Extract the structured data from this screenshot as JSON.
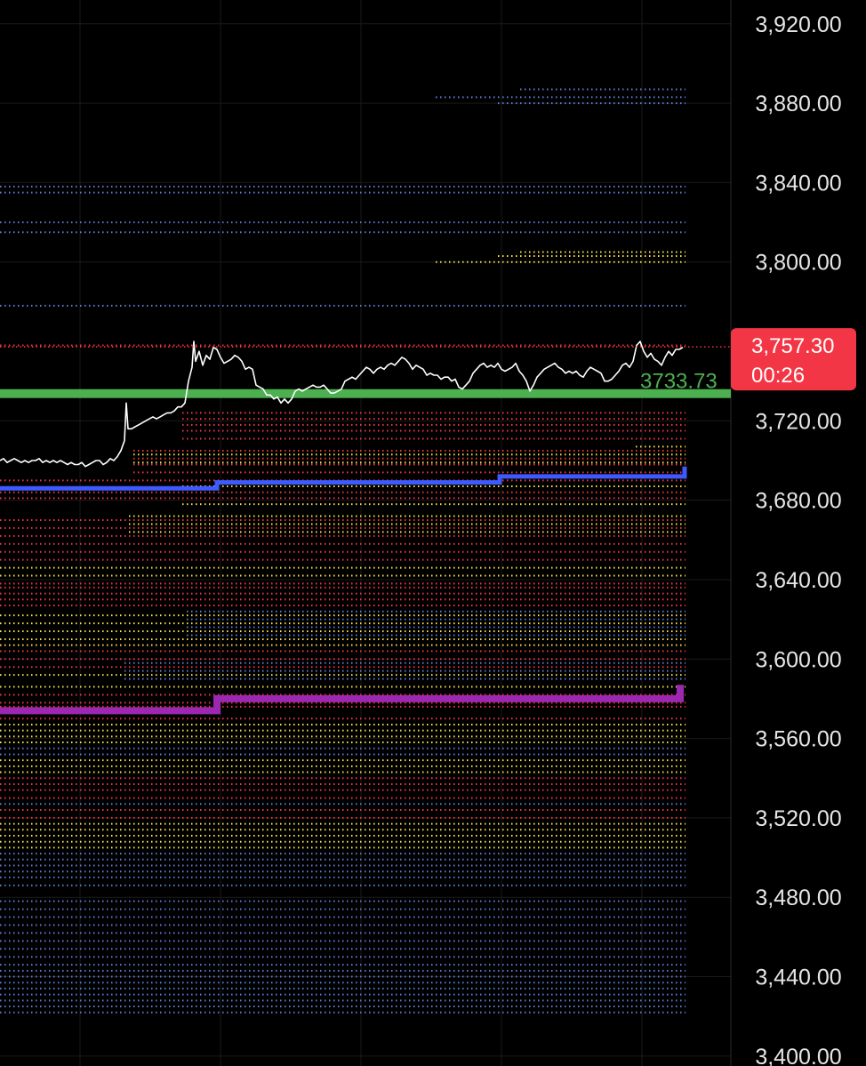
{
  "chart_data": {
    "type": "line",
    "instrument_price_axis": {
      "ylim": [
        3395,
        3932
      ],
      "tick_labels": [
        "3,920.00",
        "3,880.00",
        "3,840.00",
        "3,800.00",
        "3,720.00",
        "3,680.00",
        "3,640.00",
        "3,600.00",
        "3,560.00",
        "3,520.00",
        "3,480.00",
        "3,440.00",
        "3,400.00"
      ],
      "tick_values": [
        3920,
        3880,
        3840,
        3800,
        3720,
        3680,
        3640,
        3600,
        3560,
        3520,
        3480,
        3440,
        3400
      ]
    },
    "grid": true,
    "last_price": {
      "value": 3757.3,
      "label": "3,757.30",
      "countdown": "00:26",
      "color": "#f23645"
    },
    "marker_line": {
      "value": 3733.73,
      "label": "3733.73",
      "color": "#4caf50"
    },
    "price_series": {
      "color": "#ffffff",
      "points": [
        [
          0,
          3700
        ],
        [
          4,
          3701
        ],
        [
          8,
          3699
        ],
        [
          12,
          3700
        ],
        [
          16,
          3701
        ],
        [
          20,
          3700
        ],
        [
          24,
          3699
        ],
        [
          28,
          3700
        ],
        [
          32,
          3699
        ],
        [
          36,
          3700
        ],
        [
          40,
          3700
        ],
        [
          44,
          3701
        ],
        [
          48,
          3699
        ],
        [
          52,
          3700
        ],
        [
          56,
          3699
        ],
        [
          60,
          3700
        ],
        [
          64,
          3699
        ],
        [
          68,
          3700
        ],
        [
          72,
          3699
        ],
        [
          76,
          3698
        ],
        [
          80,
          3699
        ],
        [
          84,
          3698
        ],
        [
          88,
          3698
        ],
        [
          92,
          3699
        ],
        [
          96,
          3697
        ],
        [
          100,
          3698
        ],
        [
          104,
          3699
        ],
        [
          108,
          3700
        ],
        [
          112,
          3700
        ],
        [
          116,
          3698
        ],
        [
          120,
          3699
        ],
        [
          124,
          3701
        ],
        [
          128,
          3700
        ],
        [
          132,
          3702
        ],
        [
          136,
          3705
        ],
        [
          140,
          3710
        ],
        [
          142,
          3729
        ],
        [
          144,
          3716
        ],
        [
          148,
          3716
        ],
        [
          152,
          3717
        ],
        [
          156,
          3718
        ],
        [
          160,
          3719
        ],
        [
          164,
          3720
        ],
        [
          168,
          3721
        ],
        [
          172,
          3722
        ],
        [
          176,
          3721
        ],
        [
          180,
          3722
        ],
        [
          184,
          3723
        ],
        [
          188,
          3724
        ],
        [
          192,
          3724
        ],
        [
          196,
          3725
        ],
        [
          200,
          3727
        ],
        [
          204,
          3727
        ],
        [
          208,
          3729
        ],
        [
          212,
          3740
        ],
        [
          216,
          3747
        ],
        [
          218,
          3760
        ],
        [
          220,
          3750
        ],
        [
          224,
          3755
        ],
        [
          228,
          3748
        ],
        [
          232,
          3753
        ],
        [
          236,
          3751
        ],
        [
          240,
          3757
        ],
        [
          244,
          3756
        ],
        [
          248,
          3752
        ],
        [
          252,
          3749
        ],
        [
          256,
          3750
        ],
        [
          260,
          3751
        ],
        [
          264,
          3753
        ],
        [
          268,
          3752
        ],
        [
          272,
          3750
        ],
        [
          276,
          3746
        ],
        [
          280,
          3747
        ],
        [
          284,
          3746
        ],
        [
          288,
          3738
        ],
        [
          292,
          3737
        ],
        [
          296,
          3736
        ],
        [
          300,
          3733
        ],
        [
          304,
          3733
        ],
        [
          308,
          3731
        ],
        [
          312,
          3732
        ],
        [
          316,
          3729
        ],
        [
          320,
          3731
        ],
        [
          324,
          3729
        ],
        [
          328,
          3731
        ],
        [
          332,
          3735
        ],
        [
          336,
          3736
        ],
        [
          340,
          3735
        ],
        [
          344,
          3736
        ],
        [
          348,
          3737
        ],
        [
          352,
          3738
        ],
        [
          356,
          3737
        ],
        [
          360,
          3737
        ],
        [
          364,
          3738
        ],
        [
          368,
          3736
        ],
        [
          372,
          3734
        ],
        [
          376,
          3734
        ],
        [
          380,
          3735
        ],
        [
          384,
          3736
        ],
        [
          388,
          3740
        ],
        [
          392,
          3741
        ],
        [
          396,
          3742
        ],
        [
          400,
          3741
        ],
        [
          404,
          3743
        ],
        [
          408,
          3745
        ],
        [
          412,
          3747
        ],
        [
          416,
          3746
        ],
        [
          420,
          3744
        ],
        [
          424,
          3746
        ],
        [
          428,
          3747
        ],
        [
          432,
          3746
        ],
        [
          436,
          3748
        ],
        [
          440,
          3749
        ],
        [
          444,
          3748
        ],
        [
          448,
          3750
        ],
        [
          452,
          3752
        ],
        [
          456,
          3751
        ],
        [
          460,
          3749
        ],
        [
          464,
          3746
        ],
        [
          468,
          3748
        ],
        [
          472,
          3747
        ],
        [
          476,
          3746
        ],
        [
          480,
          3743
        ],
        [
          484,
          3744
        ],
        [
          488,
          3743
        ],
        [
          492,
          3743
        ],
        [
          496,
          3741
        ],
        [
          500,
          3742
        ],
        [
          504,
          3742
        ],
        [
          508,
          3740
        ],
        [
          512,
          3741
        ],
        [
          516,
          3737
        ],
        [
          520,
          3736
        ],
        [
          524,
          3738
        ],
        [
          528,
          3740
        ],
        [
          532,
          3744
        ],
        [
          536,
          3746
        ],
        [
          540,
          3748
        ],
        [
          544,
          3749
        ],
        [
          548,
          3747
        ],
        [
          552,
          3748
        ],
        [
          556,
          3747
        ],
        [
          560,
          3749
        ],
        [
          564,
          3746
        ],
        [
          568,
          3745
        ],
        [
          572,
          3746
        ],
        [
          576,
          3747
        ],
        [
          580,
          3749
        ],
        [
          584,
          3745
        ],
        [
          588,
          3743
        ],
        [
          592,
          3740
        ],
        [
          596,
          3735
        ],
        [
          600,
          3738
        ],
        [
          604,
          3742
        ],
        [
          608,
          3744
        ],
        [
          612,
          3746
        ],
        [
          616,
          3747
        ],
        [
          620,
          3748
        ],
        [
          624,
          3749
        ],
        [
          628,
          3747
        ],
        [
          632,
          3746
        ],
        [
          636,
          3744
        ],
        [
          640,
          3745
        ],
        [
          644,
          3744
        ],
        [
          648,
          3745
        ],
        [
          652,
          3743
        ],
        [
          656,
          3742
        ],
        [
          660,
          3745
        ],
        [
          664,
          3747
        ],
        [
          668,
          3746
        ],
        [
          672,
          3745
        ],
        [
          676,
          3744
        ],
        [
          680,
          3740
        ],
        [
          684,
          3740
        ],
        [
          688,
          3741
        ],
        [
          692,
          3743
        ],
        [
          696,
          3745
        ],
        [
          700,
          3748
        ],
        [
          704,
          3749
        ],
        [
          708,
          3747
        ],
        [
          712,
          3750
        ],
        [
          716,
          3758
        ],
        [
          720,
          3760
        ],
        [
          724,
          3755
        ],
        [
          728,
          3752
        ],
        [
          732,
          3754
        ],
        [
          736,
          3751
        ],
        [
          740,
          3750
        ],
        [
          744,
          3748
        ],
        [
          748,
          3752
        ],
        [
          752,
          3755
        ],
        [
          756,
          3753
        ],
        [
          760,
          3756
        ],
        [
          764,
          3756
        ],
        [
          768,
          3757
        ]
      ]
    },
    "step_lines": [
      {
        "color": "#3d5afe",
        "points": [
          [
            0,
            3686
          ],
          [
            244,
            3686
          ],
          [
            244,
            3689
          ],
          [
            562,
            3689
          ],
          [
            562,
            3692
          ],
          [
            770,
            3692
          ],
          [
            770,
            3697
          ]
        ]
      },
      {
        "color": "#9c27b0",
        "points": [
          [
            0,
            3574
          ],
          [
            244,
            3574
          ],
          [
            244,
            3580
          ],
          [
            765,
            3580
          ],
          [
            765,
            3587
          ]
        ]
      }
    ],
    "level_bands": [
      {
        "color": "#5b7fd6",
        "x0": 585,
        "values": [
          3887
        ]
      },
      {
        "color": "#5b7fd6",
        "x0": 490,
        "values": [
          3883
        ]
      },
      {
        "color": "#5b7fd6",
        "x0": 560,
        "values": [
          3880
        ]
      },
      {
        "color": "#5b7fd6",
        "x0": 0,
        "values": [
          3838,
          3835,
          3820,
          3815,
          3778
        ]
      },
      {
        "color": "#f7e34a",
        "x0": 585,
        "values": [
          3805
        ]
      },
      {
        "color": "#f7e34a",
        "x0": 560,
        "values": [
          3803
        ]
      },
      {
        "color": "#f7e34a",
        "x0": 490,
        "values": [
          3800
        ]
      },
      {
        "color": "#f23645",
        "x0": 0,
        "values": [
          3758
        ]
      },
      {
        "color": "#f23645",
        "x0": 205,
        "values": [
          3724,
          3721,
          3718,
          3715,
          3711
        ]
      },
      {
        "color": "#f7e34a",
        "x0": 715,
        "values": [
          3707
        ]
      },
      {
        "color": "#f23645",
        "x0": 150,
        "values": [
          3705,
          3701,
          3698,
          3694
        ]
      },
      {
        "color": "#f7e34a",
        "x0": 150,
        "values": [
          3703,
          3699
        ]
      },
      {
        "color": "#f23645",
        "x0": 0,
        "values": [
          3690,
          3684,
          3681
        ]
      },
      {
        "color": "#f7e34a",
        "x0": 205,
        "values": [
          3687,
          3678
        ]
      },
      {
        "color": "#f23645",
        "x0": 0,
        "values": [
          3670,
          3666,
          3662,
          3658,
          3654,
          3650
        ]
      },
      {
        "color": "#f7e34a",
        "x0": 145,
        "values": [
          3672,
          3668,
          3664
        ]
      },
      {
        "color": "#f7e34a",
        "x0": 0,
        "values": [
          3646,
          3642
        ]
      },
      {
        "color": "#f23645",
        "x0": 0,
        "values": [
          3638,
          3636,
          3633,
          3630,
          3627
        ]
      },
      {
        "color": "#5b7fd6",
        "x0": 210,
        "values": [
          3624,
          3620,
          3616,
          3612
        ]
      },
      {
        "color": "#f7e34a",
        "x0": 0,
        "values": [
          3622,
          3618,
          3614,
          3610,
          3607
        ]
      },
      {
        "color": "#f23645",
        "x0": 0,
        "values": [
          3604,
          3600,
          3596
        ]
      },
      {
        "color": "#5b7fd6",
        "x0": 140,
        "values": [
          3598,
          3594,
          3590
        ]
      },
      {
        "color": "#f7e34a",
        "x0": 0,
        "values": [
          3592,
          3586
        ]
      },
      {
        "color": "#f23645",
        "x0": 0,
        "values": [
          3582,
          3578,
          3576,
          3570
        ]
      },
      {
        "color": "#f7e34a",
        "x0": 0,
        "values": [
          3567,
          3564,
          3561,
          3558
        ]
      },
      {
        "color": "#5b7fd6",
        "x0": 0,
        "values": [
          3555,
          3552
        ]
      },
      {
        "color": "#f7e34a",
        "x0": 0,
        "values": [
          3549,
          3546,
          3543
        ]
      },
      {
        "color": "#f23645",
        "x0": 0,
        "values": [
          3540,
          3537,
          3534,
          3530
        ]
      },
      {
        "color": "#5b7fd6",
        "x0": 0,
        "values": [
          3527
        ]
      },
      {
        "color": "#f23645",
        "x0": 0,
        "values": [
          3524,
          3520
        ]
      },
      {
        "color": "#f7e34a",
        "x0": 0,
        "values": [
          3517,
          3514,
          3511,
          3508,
          3505
        ]
      },
      {
        "color": "#5b7fd6",
        "x0": 0,
        "values": [
          3502,
          3499,
          3496,
          3493,
          3490,
          3486,
          3478,
          3474,
          3470,
          3466,
          3462,
          3458,
          3454,
          3450,
          3446,
          3443,
          3440,
          3437,
          3434,
          3431,
          3428,
          3425,
          3422
        ]
      }
    ]
  }
}
